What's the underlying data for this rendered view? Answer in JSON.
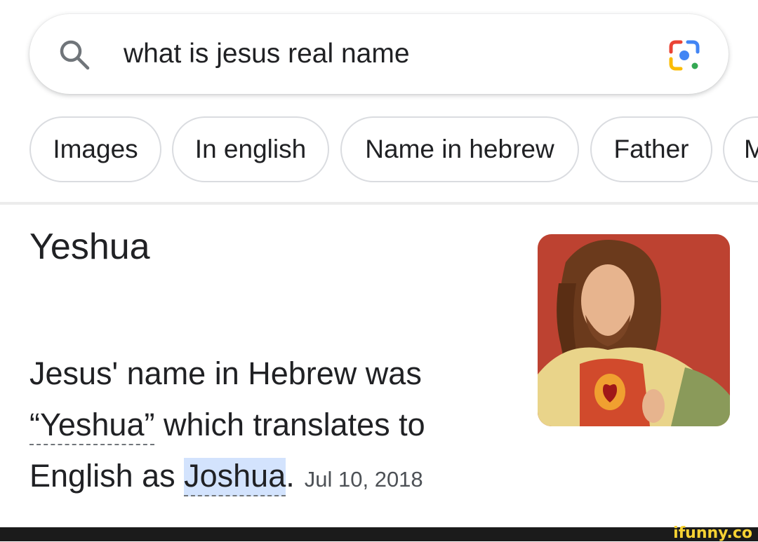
{
  "search": {
    "query": "what is jesus real name",
    "search_icon": "search-icon",
    "lens_icon": "google-lens-icon"
  },
  "chips": [
    {
      "label": "Images"
    },
    {
      "label": "In english"
    },
    {
      "label": "Name in hebrew"
    },
    {
      "label": "Father"
    },
    {
      "label": "M"
    }
  ],
  "answer": {
    "title": "Yeshua",
    "snippet_part1": "Jesus' name in Hebrew was ",
    "snippet_quoted": "“Yeshua”",
    "snippet_part2": " which translates to English as ",
    "snippet_highlight": "Joshua",
    "snippet_end": ".",
    "date": "Jul 10, 2018"
  },
  "image": {
    "icon": "jesus-painting-thumbnail"
  },
  "watermark": {
    "text": "ifunny.co"
  },
  "colors": {
    "highlight": "#d3e3fd",
    "watermark": "#f7d233",
    "footer": "#1b1b1b"
  }
}
